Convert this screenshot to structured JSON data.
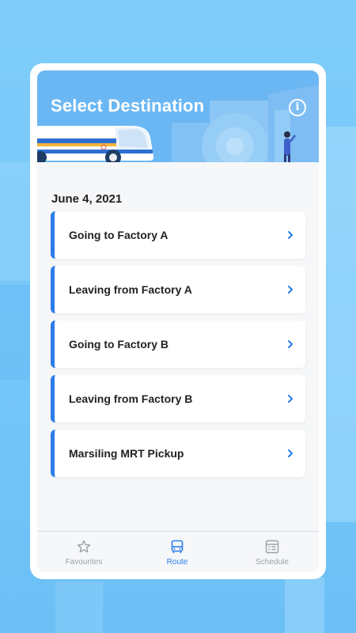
{
  "header": {
    "title": "Select Destination",
    "info_icon": "info-icon"
  },
  "date": "June 4, 2021",
  "routes": [
    {
      "label": "Going to Factory A"
    },
    {
      "label": "Leaving from Factory A"
    },
    {
      "label": "Going to Factory B"
    },
    {
      "label": "Leaving from Factory B"
    },
    {
      "label": "Marsiling MRT Pickup"
    }
  ],
  "tabs": [
    {
      "label": "Favourites",
      "icon": "star-icon"
    },
    {
      "label": "Route",
      "icon": "bus-icon"
    },
    {
      "label": "Schedule",
      "icon": "schedule-icon"
    }
  ],
  "colors": {
    "accent": "#2b7de9",
    "header_bg": "#6bb7f3",
    "page_bg": "#80cdfb",
    "inactive_tab": "#9aa1a9"
  }
}
